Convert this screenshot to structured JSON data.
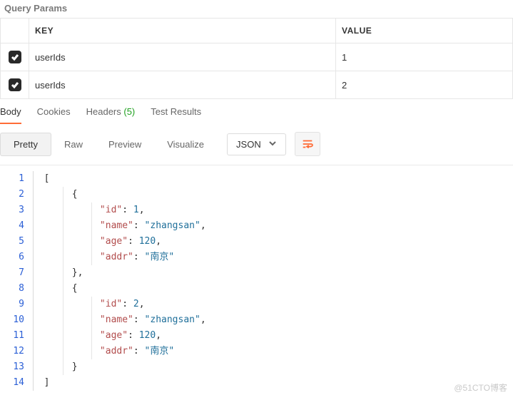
{
  "section_title": "Query Params",
  "params": {
    "headers": {
      "key": "KEY",
      "value": "VALUE"
    },
    "rows": [
      {
        "checked": true,
        "key": "userIds",
        "value": "1"
      },
      {
        "checked": true,
        "key": "userIds",
        "value": "2"
      }
    ]
  },
  "response_tabs": {
    "body": "Body",
    "cookies": "Cookies",
    "headers": "Headers",
    "headers_count": "(5)",
    "test_results": "Test Results"
  },
  "view_modes": {
    "pretty": "Pretty",
    "raw": "Raw",
    "preview": "Preview",
    "visualize": "Visualize"
  },
  "format_select": "JSON",
  "code": {
    "lines": [
      {
        "n": "1",
        "indent": 0,
        "tokens": [
          [
            "br",
            "["
          ]
        ]
      },
      {
        "n": "2",
        "indent": 1,
        "tokens": [
          [
            "br",
            "{"
          ]
        ]
      },
      {
        "n": "3",
        "indent": 2,
        "tokens": [
          [
            "key",
            "\"id\""
          ],
          [
            "pun",
            ": "
          ],
          [
            "num",
            "1"
          ],
          [
            "pun",
            ","
          ]
        ]
      },
      {
        "n": "4",
        "indent": 2,
        "tokens": [
          [
            "key",
            "\"name\""
          ],
          [
            "pun",
            ": "
          ],
          [
            "str",
            "\"zhangsan\""
          ],
          [
            "pun",
            ","
          ]
        ]
      },
      {
        "n": "5",
        "indent": 2,
        "tokens": [
          [
            "key",
            "\"age\""
          ],
          [
            "pun",
            ": "
          ],
          [
            "num",
            "120"
          ],
          [
            "pun",
            ","
          ]
        ]
      },
      {
        "n": "6",
        "indent": 2,
        "tokens": [
          [
            "key",
            "\"addr\""
          ],
          [
            "pun",
            ": "
          ],
          [
            "str",
            "\"南京\""
          ]
        ]
      },
      {
        "n": "7",
        "indent": 1,
        "tokens": [
          [
            "br",
            "}"
          ],
          [
            "pun",
            ","
          ]
        ]
      },
      {
        "n": "8",
        "indent": 1,
        "tokens": [
          [
            "br",
            "{"
          ]
        ]
      },
      {
        "n": "9",
        "indent": 2,
        "tokens": [
          [
            "key",
            "\"id\""
          ],
          [
            "pun",
            ": "
          ],
          [
            "num",
            "2"
          ],
          [
            "pun",
            ","
          ]
        ]
      },
      {
        "n": "10",
        "indent": 2,
        "tokens": [
          [
            "key",
            "\"name\""
          ],
          [
            "pun",
            ": "
          ],
          [
            "str",
            "\"zhangsan\""
          ],
          [
            "pun",
            ","
          ]
        ]
      },
      {
        "n": "11",
        "indent": 2,
        "tokens": [
          [
            "key",
            "\"age\""
          ],
          [
            "pun",
            ": "
          ],
          [
            "num",
            "120"
          ],
          [
            "pun",
            ","
          ]
        ]
      },
      {
        "n": "12",
        "indent": 2,
        "tokens": [
          [
            "key",
            "\"addr\""
          ],
          [
            "pun",
            ": "
          ],
          [
            "str",
            "\"南京\""
          ]
        ]
      },
      {
        "n": "13",
        "indent": 1,
        "tokens": [
          [
            "br",
            "}"
          ]
        ]
      },
      {
        "n": "14",
        "indent": 0,
        "tokens": [
          [
            "br",
            "]"
          ]
        ]
      }
    ]
  },
  "watermark": "@51CTO博客"
}
